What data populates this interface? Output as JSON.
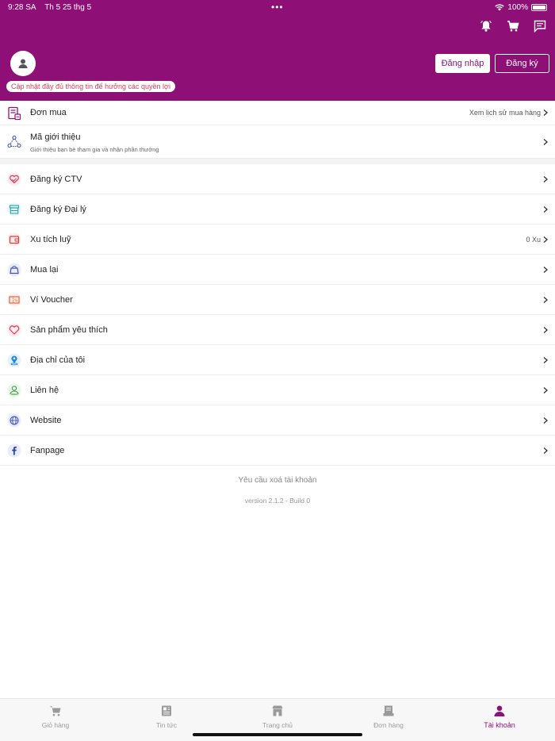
{
  "status": {
    "time": "9:28 SA",
    "date": "Th 5 25 thg 5",
    "dots": "•••",
    "battery": "100%"
  },
  "header": {
    "update_notice": "Cập nhật đầy đủ thông tin để hưởng các quyền lợi",
    "login_label": "Đăng nhập",
    "register_label": "Đăng ký",
    "icons": [
      "bell-icon",
      "cart-icon",
      "message-icon"
    ]
  },
  "menu": {
    "orders": {
      "label": "Đơn mua",
      "right": "Xem lịch sử mua hàng"
    },
    "referral": {
      "label": "Mã giới thiệu",
      "sub": "Giới thiệu bạn bè tham gia và nhận phần thưởng"
    },
    "items": [
      {
        "label": "Đăng ký CTV",
        "right": ""
      },
      {
        "label": "Đăng ký Đại lý",
        "right": ""
      },
      {
        "label": "Xu tích luỹ",
        "right": "0 Xu"
      },
      {
        "label": "Mua lại",
        "right": ""
      },
      {
        "label": "Ví Voucher",
        "right": ""
      },
      {
        "label": "Sản phẩm yêu thích",
        "right": ""
      },
      {
        "label": "Địa chỉ của tôi",
        "right": ""
      },
      {
        "label": "Liên hệ",
        "right": ""
      },
      {
        "label": "Website",
        "right": ""
      },
      {
        "label": "Fanpage",
        "right": ""
      }
    ]
  },
  "footer": {
    "delete_request": "Yêu cầu xoá tài khoản",
    "version": "version 2.1.2 - Build 0"
  },
  "tabs": [
    {
      "label": "Giỏ hàng",
      "active": false
    },
    {
      "label": "Tin tức",
      "active": false
    },
    {
      "label": "Trang chủ",
      "active": false
    },
    {
      "label": "Đơn hàng",
      "active": false
    },
    {
      "label": "Tài khoản",
      "active": true
    }
  ],
  "colors": {
    "brand": "#8e1077",
    "accent_red": "#e23a55"
  }
}
